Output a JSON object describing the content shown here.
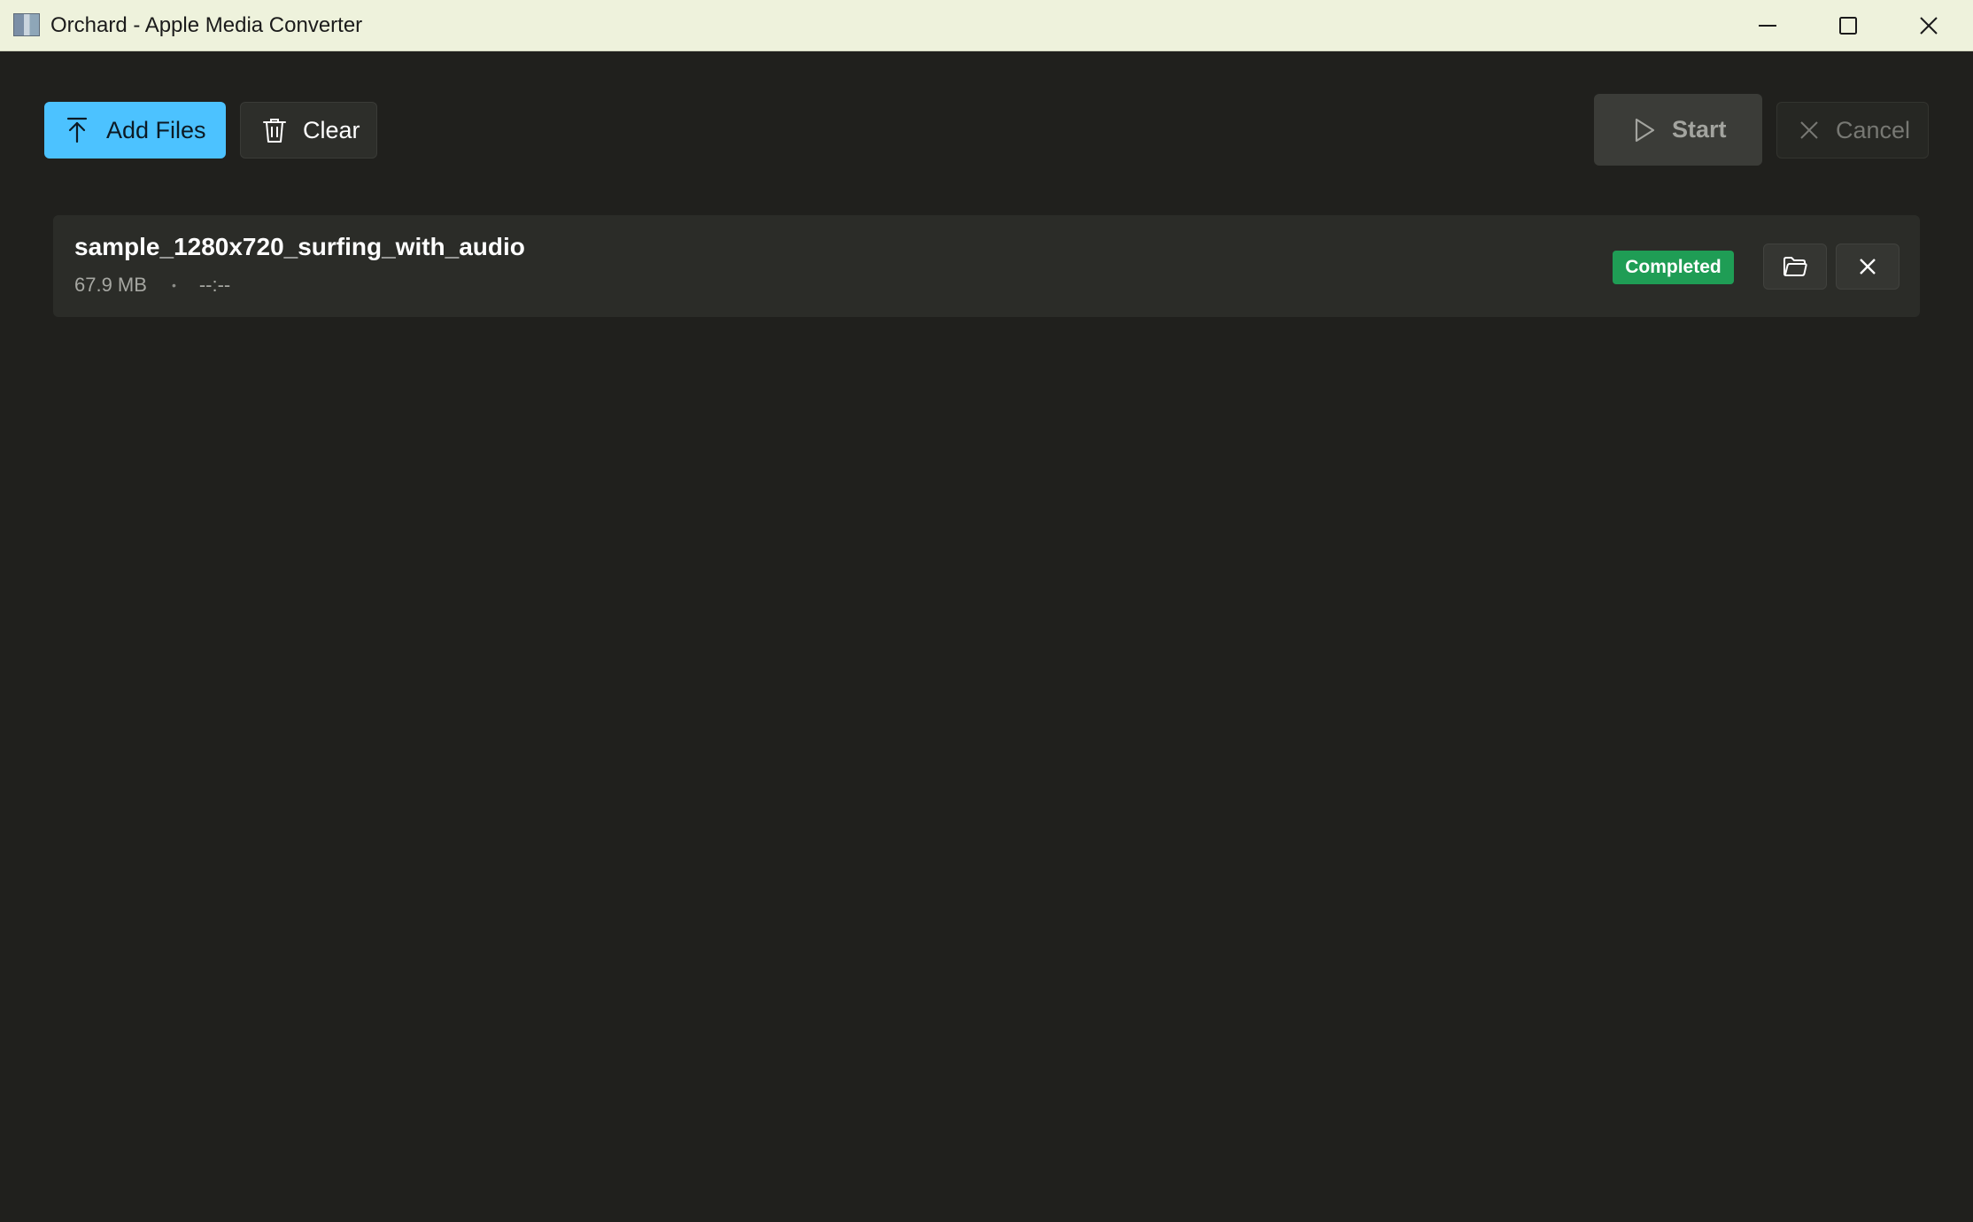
{
  "window": {
    "title": "Orchard - Apple Media Converter",
    "app_icon": "app-icon",
    "controls": [
      "minimize-icon",
      "maximize-icon",
      "close-icon"
    ]
  },
  "toolbar": {
    "add_files": {
      "label": "Add Files",
      "icon": "upload-icon"
    },
    "clear": {
      "label": "Clear",
      "icon": "trash-icon"
    },
    "start": {
      "label": "Start",
      "icon": "play-icon",
      "enabled": false
    },
    "cancel": {
      "label": "Cancel",
      "icon": "close-icon",
      "enabled": false
    }
  },
  "files": [
    {
      "name": "sample_1280x720_surfing_with_audio",
      "size": "67.9 MB",
      "separator": "•",
      "duration": "--:--",
      "status": "Completed",
      "actions": [
        "folder-icon",
        "close-icon"
      ]
    }
  ],
  "colors": {
    "accent": "#4cc2ff",
    "status_completed": "#1f9d55",
    "background": "#20201d",
    "titlebar": "#eef2dc"
  }
}
